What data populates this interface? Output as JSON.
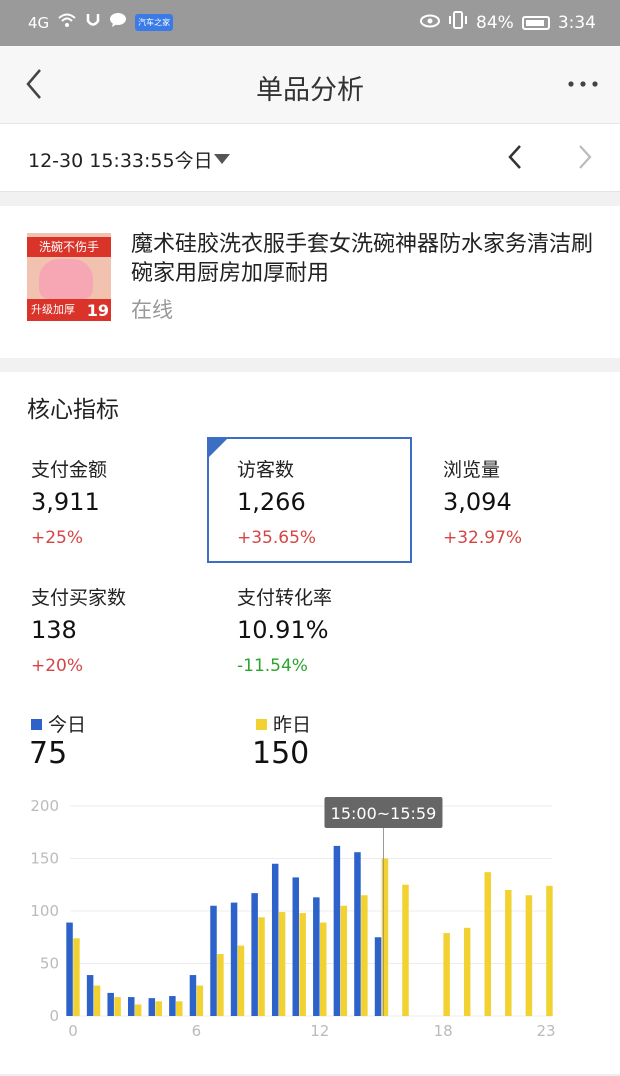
{
  "status_bar": {
    "network": "4G",
    "battery_percent": "84%",
    "time": "3:34",
    "app_badge": "汽车之家"
  },
  "header": {
    "title": "单品分析",
    "more": "···"
  },
  "date_bar": {
    "date_time": "12-30 15:33:55今日"
  },
  "product": {
    "title": "魔术硅胶洗衣服手套女洗碗神器防水家务清洁刷碗家用厨房加厚耐用",
    "status": "在线",
    "thumb_top": "洗碗不伤手",
    "thumb_bottom": "升级加厚",
    "thumb_price": "19"
  },
  "core": {
    "title": "核心指标",
    "metrics": [
      {
        "label": "支付金额",
        "value": "3,911",
        "change": "+25%",
        "trend": "up"
      },
      {
        "label": "访客数",
        "value": "1,266",
        "change": "+35.65%",
        "trend": "up",
        "selected": true
      },
      {
        "label": "浏览量",
        "value": "3,094",
        "change": "+32.97%",
        "trend": "up"
      },
      {
        "label": "支付买家数",
        "value": "138",
        "change": "+20%",
        "trend": "up"
      },
      {
        "label": "支付转化率",
        "value": "10.91%",
        "change": "-11.54%",
        "trend": "down"
      }
    ]
  },
  "legend": {
    "today_label": "今日",
    "today_value": "75",
    "yesterday_label": "昨日",
    "yesterday_value": "150"
  },
  "chart_data": {
    "type": "bar",
    "x": [
      0,
      1,
      2,
      3,
      4,
      5,
      6,
      7,
      8,
      9,
      10,
      11,
      12,
      13,
      14,
      15,
      16,
      17,
      18,
      19,
      20,
      21,
      22,
      23
    ],
    "xticks": [
      "0",
      "6",
      "12",
      "18",
      "23"
    ],
    "yticks": [
      "0",
      "50",
      "100",
      "150",
      "200"
    ],
    "ylim": [
      0,
      200
    ],
    "series": [
      {
        "name": "今日",
        "color": "#2c62c9",
        "values": [
          89,
          39,
          22,
          18,
          17,
          19,
          39,
          105,
          108,
          117,
          145,
          132,
          113,
          162,
          156,
          75,
          null,
          null,
          null,
          null,
          null,
          null,
          null,
          null
        ]
      },
      {
        "name": "昨日",
        "color": "#f2d232",
        "values": [
          74,
          29,
          18,
          11,
          14,
          14,
          29,
          59,
          67,
          94,
          99,
          98,
          89,
          105,
          115,
          150,
          125,
          0,
          79,
          84,
          137,
          120,
          115,
          124
        ]
      }
    ],
    "tooltip": "15:00~15:59",
    "tooltip_x": 15
  },
  "colors": {
    "accent": "#3c6fc4",
    "up": "#d64545",
    "down": "#2da42d",
    "today": "#2c62c9",
    "yesterday": "#f2d232"
  }
}
